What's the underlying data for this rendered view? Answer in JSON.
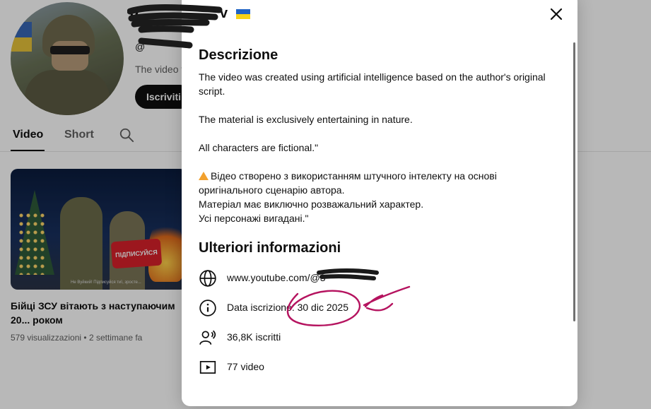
{
  "channel": {
    "name": "v",
    "handle": "@",
    "description": "The video v",
    "subscribe_label": "Iscriviti"
  },
  "tabs": [
    {
      "label": "Video"
    },
    {
      "label": "Short"
    }
  ],
  "video": {
    "thumbnail_badge": "ПІДПИСУЙСЯ",
    "thumbnail_caption": "Не Вуйкий! Підписуйся тиї, зросте...",
    "title": "Бійці ЗСУ вітають з наступаючим 20... роком",
    "views": "579 visualizzazioni",
    "separator": "•",
    "age": "2 settimane fa"
  },
  "dialog": {
    "description_heading": "Descrizione",
    "description_lines": [
      "The video was created using artificial intelligence based on the author's original",
      "script.",
      "The material is exclusively entertaining in nature.",
      "All characters are fictional.\"",
      "Відео створено з використанням штучного інтелекту на основі",
      "оригінального сценарію автора.",
      "Матеріал має виключно розважальний характер.",
      "Усі персонажі вигадані.\""
    ],
    "more_info_heading": "Ulteriori informazioni",
    "info": {
      "url": "www.youtube.com/@3",
      "joined": "Data iscrizione: 30 dic 2025",
      "subscribers": "36,8K iscritti",
      "videos": "77 video"
    },
    "icons": [
      "globe-icon",
      "info-icon",
      "subscribers-icon",
      "video-play-icon",
      "close-icon",
      "warning-icon",
      "search-icon"
    ]
  },
  "colors": {
    "annotation_marker": "#b5135f",
    "redaction": "#1a1a1a",
    "flag_blue": "#1f63c4",
    "flag_yellow": "#f7d317"
  }
}
